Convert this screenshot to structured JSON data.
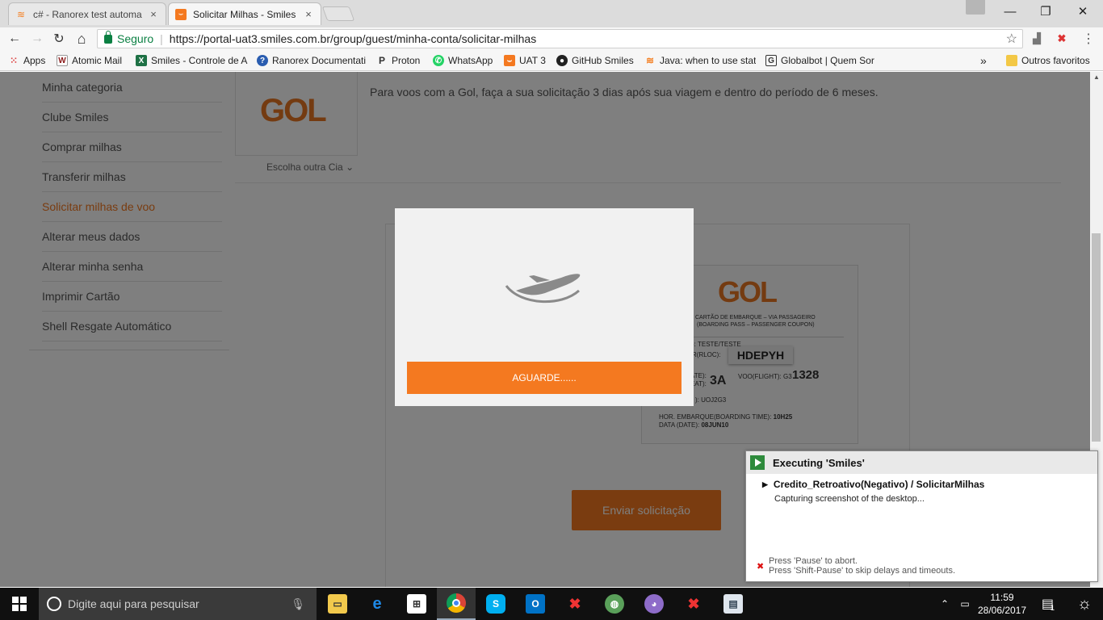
{
  "browser": {
    "tabs": [
      {
        "title": "c# - Ranorex test automa",
        "close": "×"
      },
      {
        "title": "Solicitar Milhas - Smiles",
        "close": "×"
      }
    ],
    "window_controls": {
      "minimize": "—",
      "restore": "❐",
      "close": "✕"
    },
    "nav": {
      "back": "←",
      "forward": "→",
      "reload": "↻",
      "home": "⌂"
    },
    "security_label": "Seguro",
    "url": "https://portal-uat3.smiles.com.br/group/guest/minha-conta/solicitar-milhas",
    "bookmarks_overflow": "»",
    "bookmarks": [
      {
        "label": "Apps"
      },
      {
        "label": "Atomic Mail"
      },
      {
        "label": "Smiles - Controle de A"
      },
      {
        "label": "Ranorex Documentati"
      },
      {
        "label": "Proton"
      },
      {
        "label": "WhatsApp"
      },
      {
        "label": "UAT 3"
      },
      {
        "label": "GitHub Smiles"
      },
      {
        "label": "Java: when to use stat"
      },
      {
        "label": "Globalbot | Quem Sor"
      }
    ],
    "other_bookmarks": "Outros favoritos"
  },
  "sidebar": {
    "items": [
      {
        "label": "Minha categoria"
      },
      {
        "label": "Clube Smiles"
      },
      {
        "label": "Comprar milhas"
      },
      {
        "label": "Transferir milhas"
      },
      {
        "label": "Solicitar milhas de voo",
        "active": true
      },
      {
        "label": "Alterar meus dados"
      },
      {
        "label": "Alterar minha senha"
      },
      {
        "label": "Imprimir Cartão"
      },
      {
        "label": "Shell Resgate Automático"
      }
    ]
  },
  "airline": {
    "logo_text": "GOL",
    "choose_other": "Escolha outra Cia"
  },
  "info_text": "Para voos com a Gol, faça a sua solicitação 3 dias após sua viagem e dentro do período de 6 meses.",
  "boarding_pass": {
    "logo_text": "GOL",
    "line1": "CARTÃO DE EMBARQUE – VIA PASSAGEIRO",
    "line2": "(BOARDING PASS – PASSENGER COUPON)",
    "name_label": "ME):",
    "name_value": "TESTE/TESTE",
    "loc_label": "DOR(RLOC):",
    "pnr": "HDEPYH",
    "date_label": "ATE):",
    "seat_label": "EAT):",
    "seat_value": "3A",
    "flight_label": "VOO(FLIGHT): G3",
    "flight_number": "1328",
    "ticket_label": "):",
    "ticket_value": "UOJ2G3",
    "boarding_time_label": "HOR. EMBARQUE(BOARDING TIME):",
    "boarding_time_value": "10H25",
    "date2_label": "DATA (DATE):",
    "date2_value": "08JUN10"
  },
  "send_button": "Enviar solicitação",
  "modal": {
    "status": "AGUARDE......"
  },
  "ranorex": {
    "title": "Executing 'Smiles'",
    "test": "Credito_Retroativo(Negativo) / SolicitarMilhas",
    "status": "Capturing screenshot of the desktop...",
    "hint1": "Press 'Pause' to abort.",
    "hint2": "Press 'Shift-Pause' to skip delays and timeouts."
  },
  "taskbar": {
    "search_placeholder": "Digite aqui para pesquisar",
    "time": "11:59",
    "date": "28/06/2017",
    "notifications": "1"
  },
  "colors": {
    "accent": "#f47920",
    "gol_orange": "#e87722",
    "secure_green": "#0b8043"
  }
}
